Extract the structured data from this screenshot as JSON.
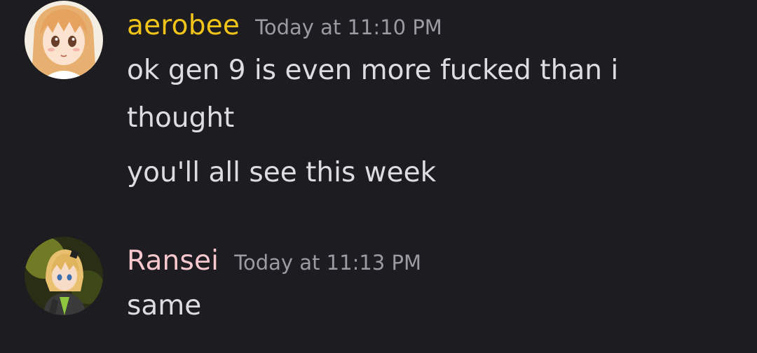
{
  "messages": [
    {
      "username": "aerobee",
      "username_color": "#f0c419",
      "timestamp": "Today at 11:10 PM",
      "avatar_icon": "anime-girl-avatar",
      "lines": [
        "ok gen 9 is even more fucked than i",
        "thought",
        "you'll all see this week"
      ]
    },
    {
      "username": "Ransei",
      "username_color": "#f8c8cf",
      "timestamp": "Today at 11:13 PM",
      "avatar_icon": "anime-character-avatar",
      "lines": [
        "same"
      ]
    }
  ]
}
